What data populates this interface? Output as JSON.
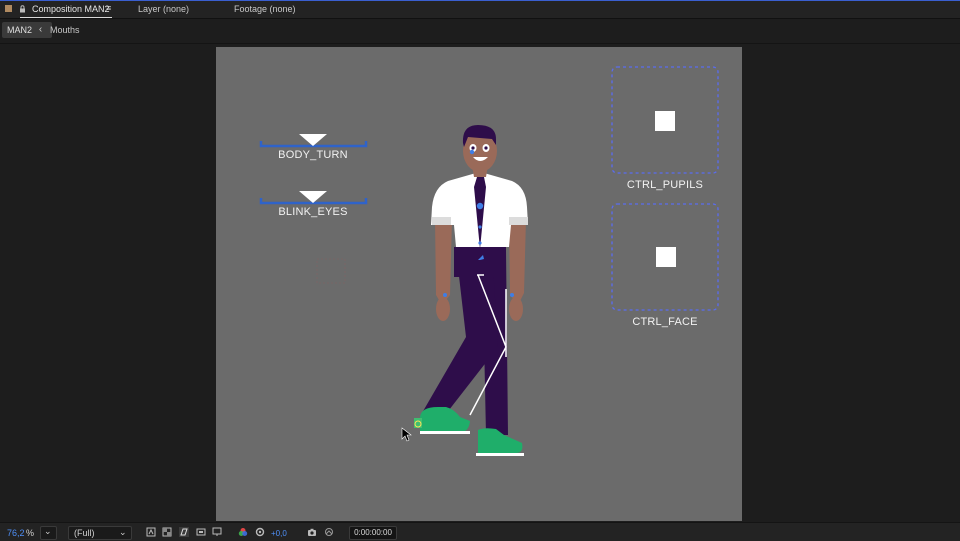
{
  "tabs": {
    "composition": "Composition MAN2",
    "layer": "Layer (none)",
    "footage": "Footage (none)"
  },
  "breadcrumb": {
    "current": "MAN2",
    "next": "Mouths"
  },
  "controls": {
    "body_turn": "BODY_TURN",
    "blink_eyes": "BLINK_EYES",
    "ctrl_pupils": "CTRL_PUPILS",
    "ctrl_face": "CTRL_FACE"
  },
  "statusbar": {
    "zoom_value": "76,2",
    "zoom_unit": "%",
    "resolution": "(Full)",
    "exposure": "+0,0",
    "timecode": "0:00:00:00"
  },
  "icons": {
    "panel_menu": "hamburger-icon",
    "lock": "lock-icon",
    "camera": "camera-icon",
    "color_channels": "rgb-icon"
  },
  "colors": {
    "accent_blue": "#4e8ff7",
    "canvas_bg": "#6b6b6b",
    "shirt": "#ffffff",
    "pants": "#2e0d4a",
    "skin": "#9a6a59",
    "shoes": "#1fae6a",
    "control_line": "#2f63c9",
    "guide_dash": "#5a6cf0"
  }
}
